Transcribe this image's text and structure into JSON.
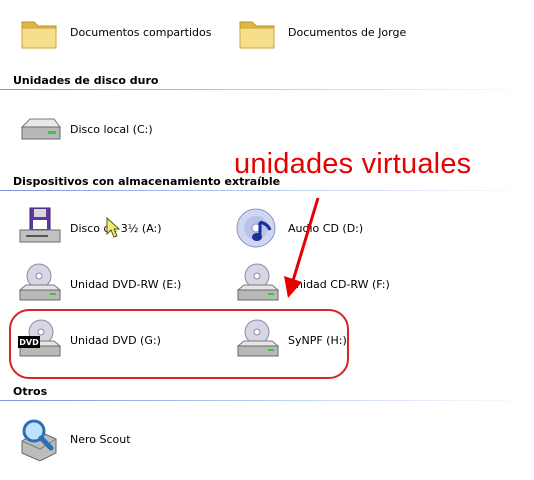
{
  "folders": [
    {
      "label": "Documentos compartidos",
      "icon": "folder-icon"
    },
    {
      "label": "Documentos de Jorge",
      "icon": "folder-icon"
    }
  ],
  "groups": {
    "hard_drives": {
      "title": "Unidades de disco duro",
      "items": [
        {
          "label": "Disco local (C:)",
          "icon": "hard-drive-icon"
        }
      ]
    },
    "removable": {
      "title": "Dispositivos con almacenamiento extraíble",
      "items": [
        {
          "label": "Disco de 3½ (A:)",
          "icon": "floppy-drive-icon"
        },
        {
          "label": "Audio CD (D:)",
          "icon": "audio-cd-icon"
        },
        {
          "label": "Unidad DVD-RW (E:)",
          "icon": "cd-drive-icon"
        },
        {
          "label": "Unidad CD-RW (F:)",
          "icon": "cd-drive-icon"
        },
        {
          "label": "Unidad DVD (G:)",
          "icon": "dvd-drive-icon",
          "badge": "DVD"
        },
        {
          "label": "SyNPF (H:)",
          "icon": "cd-drive-icon"
        }
      ]
    },
    "other": {
      "title": "Otros",
      "items": [
        {
          "label": "Nero Scout",
          "icon": "nero-scout-icon"
        }
      ]
    }
  },
  "annotation": {
    "text": "unidades virtuales",
    "color": "#e60000"
  },
  "colors": {
    "group_line": "#7a96df",
    "annotation_red": "#d8232a"
  }
}
